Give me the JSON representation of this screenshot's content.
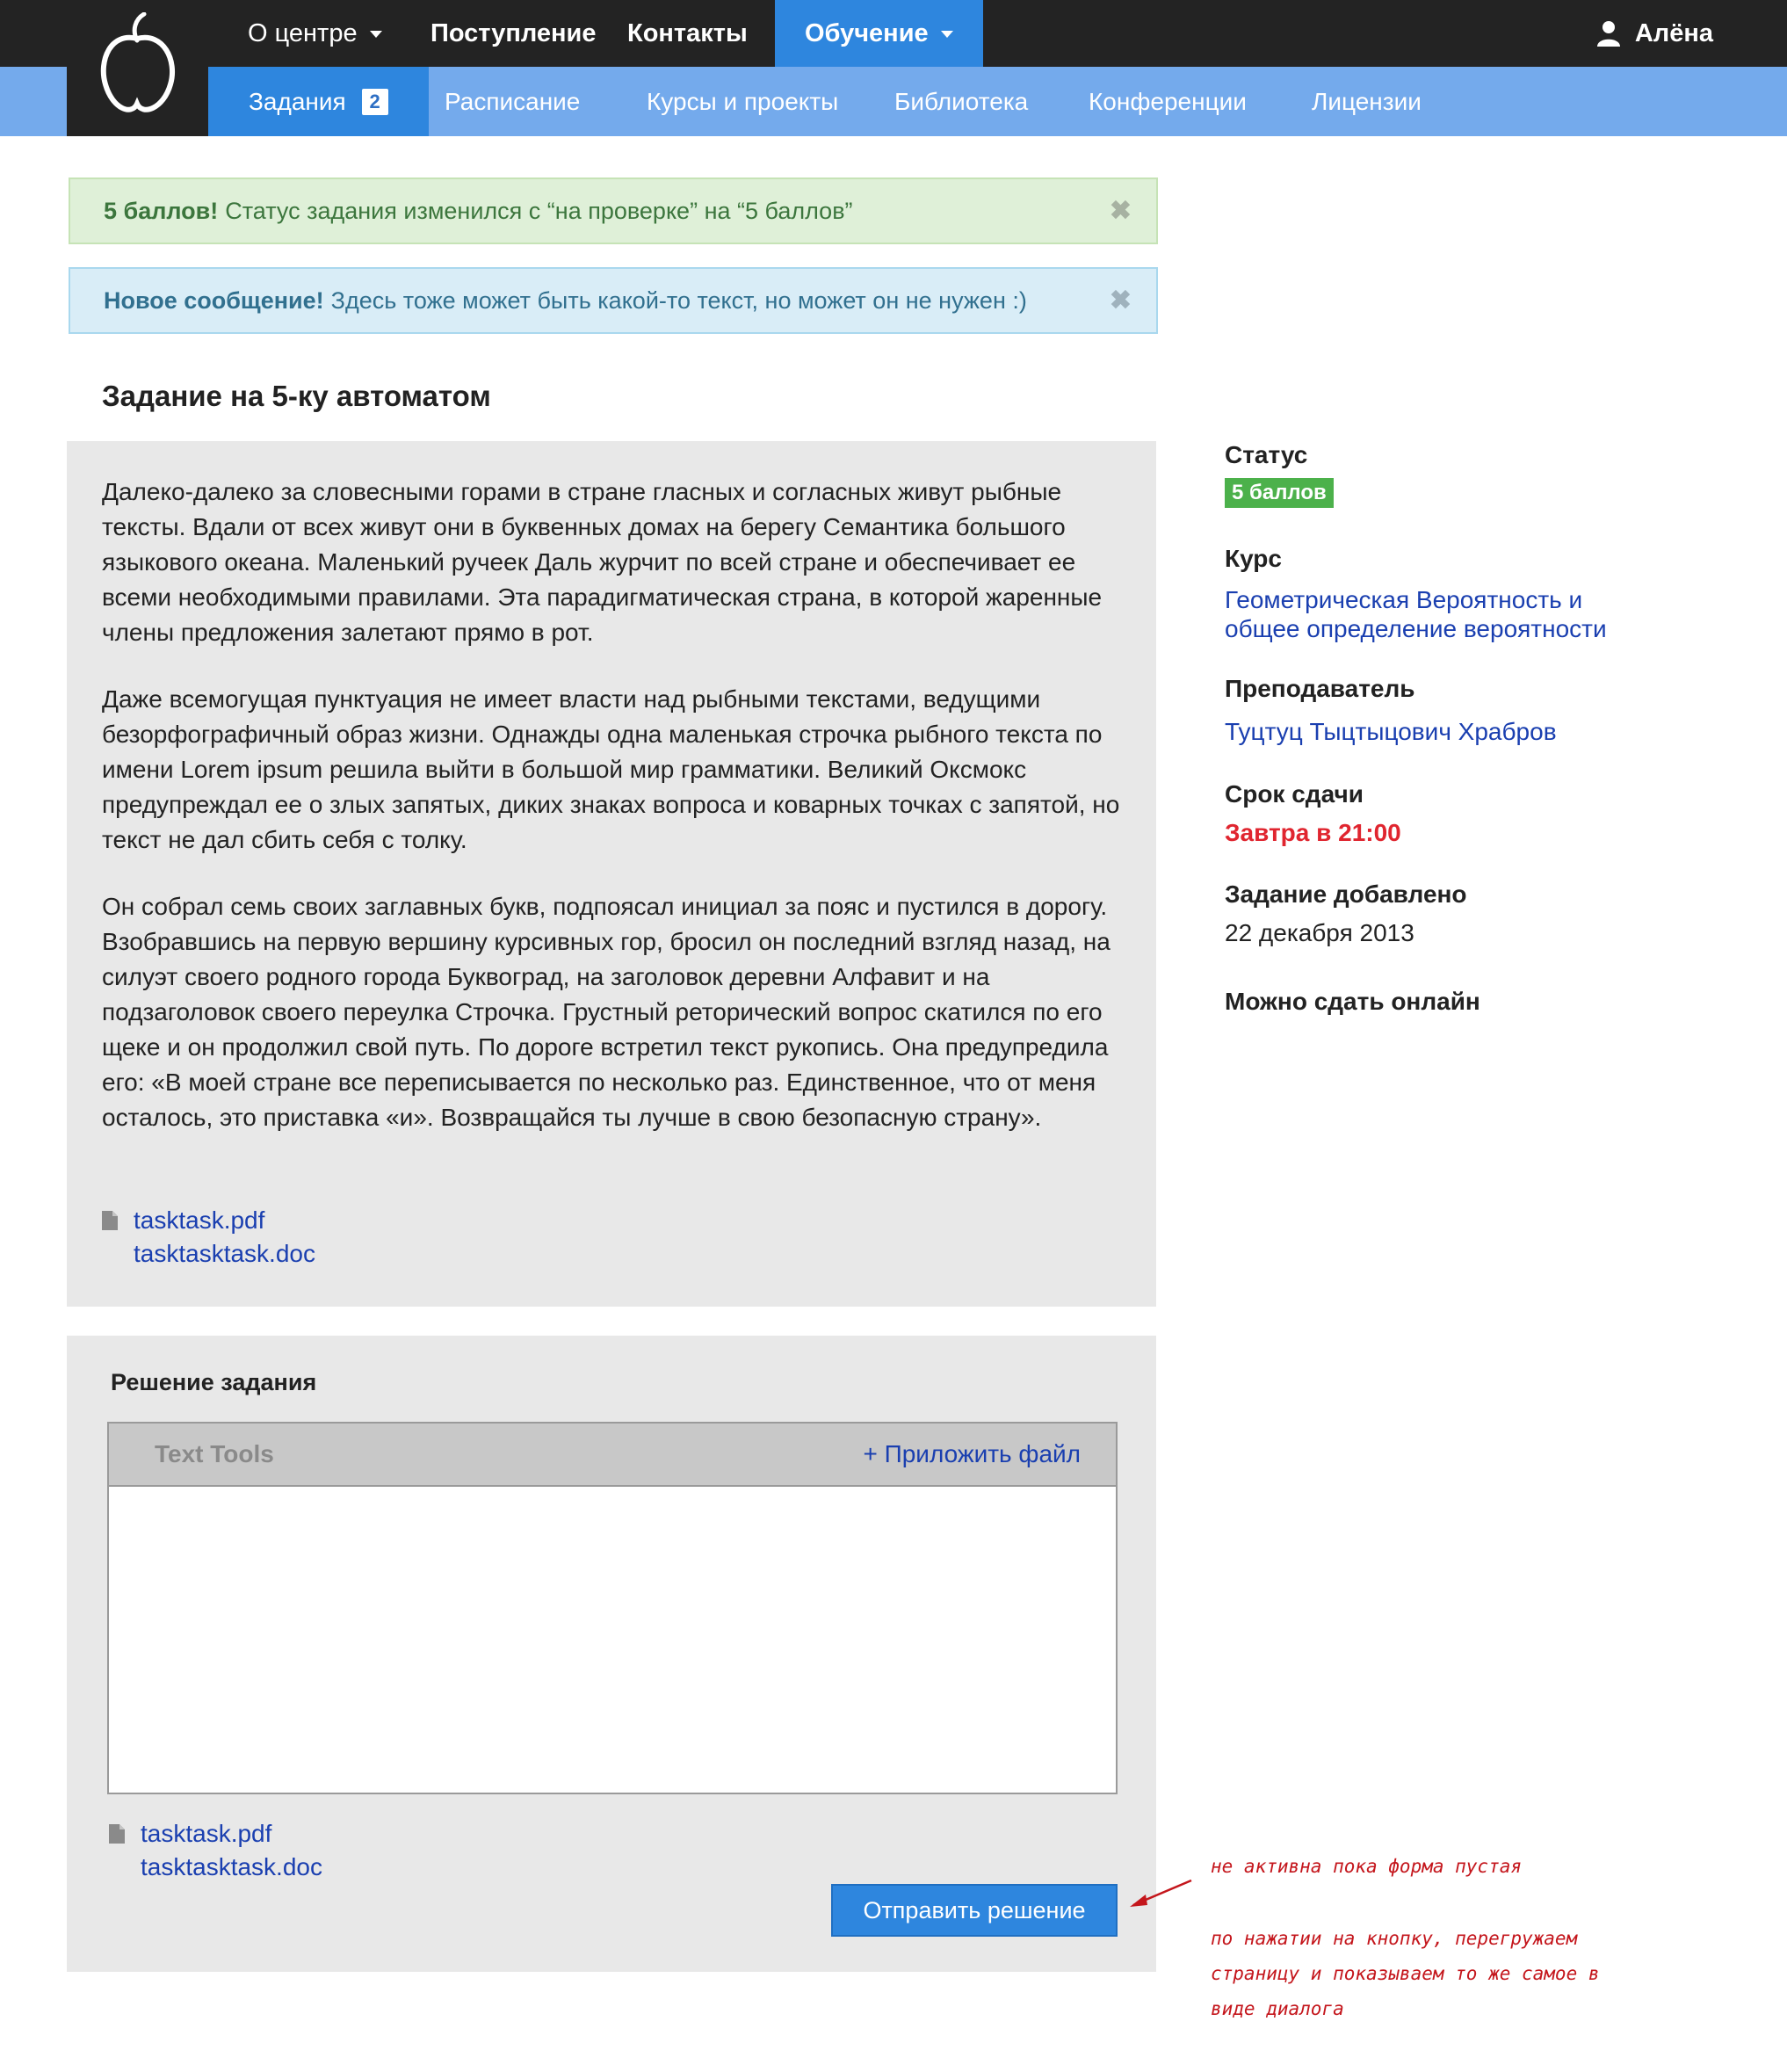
{
  "nav": {
    "top": [
      {
        "label": "О центре",
        "dropdown": true
      },
      {
        "label": "Поступление"
      },
      {
        "label": "Контакты"
      },
      {
        "label": "Обучение",
        "dropdown": true,
        "active": true
      }
    ],
    "user": "Алёна",
    "sub": [
      {
        "label": "Задания",
        "badge": "2",
        "active": true
      },
      {
        "label": "Расписание"
      },
      {
        "label": "Курсы и проекты"
      },
      {
        "label": "Библиотека"
      },
      {
        "label": "Конференции"
      },
      {
        "label": "Лицензии"
      }
    ]
  },
  "alerts": {
    "success": {
      "strong": "5 баллов!",
      "text": "Статус задания изменился с “на проверке” на “5 баллов”",
      "close": "✖"
    },
    "info": {
      "strong": "Новое сообщение!",
      "text": "Здесь тоже может быть какой-то текст, но может он не нужен :)",
      "close": "✖"
    }
  },
  "task": {
    "title": "Задание на 5-ку автоматом",
    "paragraphs": [
      "Далеко-далеко за словесными горами в стране гласных и согласных живут рыбные тексты. Вдали от всех живут они в буквенных домах на берегу Семантика большого языкового океана. Маленький ручеек Даль журчит по всей стране и обеспечивает ее всеми необходимыми правилами. Эта парадигматическая страна, в которой жаренные члены предложения залетают прямо в рот.",
      "Даже всемогущая пунктуация не имеет власти над рыбными текстами, ведущими безорфографичный образ жизни. Однажды одна маленькая строчка рыбного текста по имени Lorem ipsum решила выйти в большой мир грамматики. Великий Оксмокс предупреждал ее о злых запятых, диких знаках вопроса и коварных точках с запятой, но текст не дал сбить себя с толку.",
      "Он собрал семь своих заглавных букв, подпоясал инициал за пояс и пустился в дорогу. Взобравшись на первую вершину курсивных гор, бросил он последний взгляд назад, на силуэт своего родного города Буквоград, на заголовок деревни Алфавит и на подзаголовок своего переулка Строчка. Грустный реторический вопрос скатился по его щеке и он продолжил свой путь. По дороге встретил текст рукопись. Она предупредила его: «В моей стране все переписывается по несколько раз. Единственное, что от меня осталось, это приставка «и». Возвращайся ты лучше в свою безопасную страну»."
    ],
    "files": [
      "tasktask.pdf",
      "tasktasktask.doc"
    ]
  },
  "solution": {
    "title": "Решение задания",
    "toolbar_label": "Text Tools",
    "attach_label": "+ Приложить файл",
    "files": [
      "tasktask.pdf",
      "tasktasktask.doc"
    ],
    "submit_label": "Отправить решение"
  },
  "sidebar": {
    "status_label": "Статус",
    "status_value": "5 баллов",
    "course_label": "Курс",
    "course_line1": "Геометрическая Вероятность и",
    "course_line2": "общее определение вероятности",
    "teacher_label": "Преподаватель",
    "teacher_value": "Туцтуц Тыцтыцович Храбров",
    "deadline_label": "Срок сдачи",
    "deadline_value": "Завтра в 21:00",
    "added_label": "Задание добавлено",
    "added_value": "22 декабря 2013",
    "online_label": "Можно сдать онлайн"
  },
  "annotations": {
    "note1": "не активна пока форма пустая",
    "note2_lines": [
      "по нажатии на кнопку, перегружаем",
      "страницу и показываем то же самое в",
      "виде диалога"
    ]
  },
  "colors": {
    "topbar": "#232323",
    "subbar": "#74aaec",
    "active_nav": "#2e86de",
    "link": "#1a3fb0",
    "status_green": "#4cb14b",
    "deadline_red": "#e0252f",
    "note_red": "#c4161c"
  }
}
